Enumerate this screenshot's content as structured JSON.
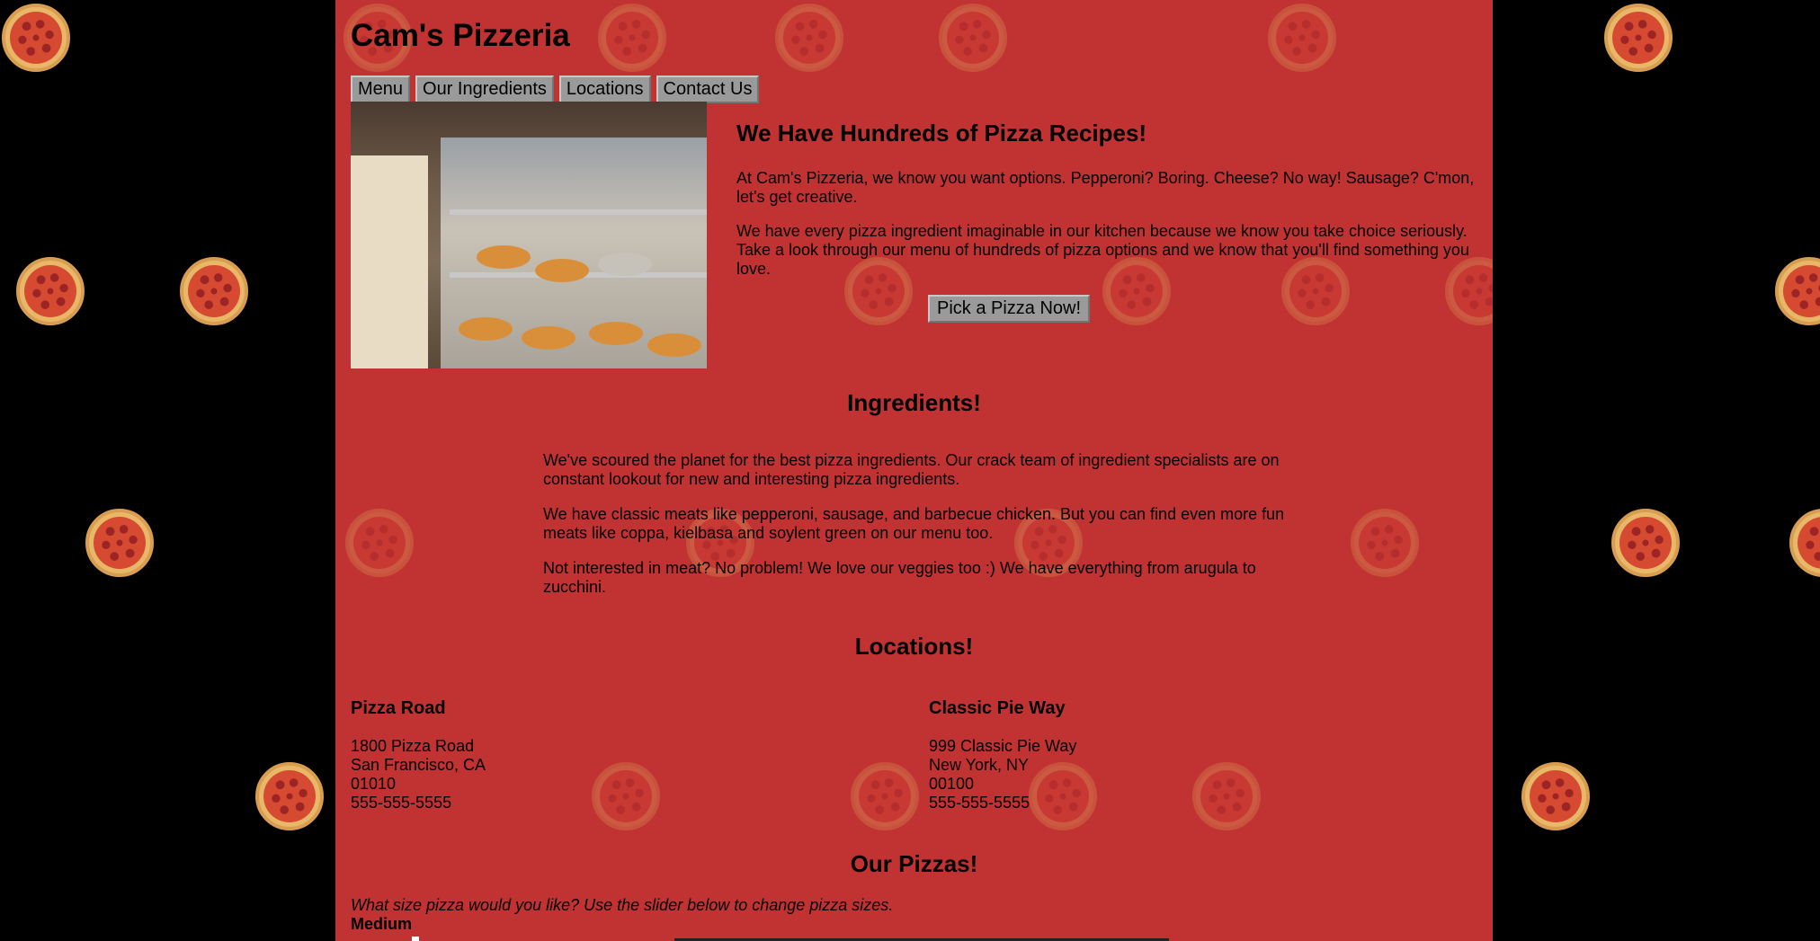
{
  "header": {
    "title": "Cam's Pizzeria"
  },
  "nav": {
    "items": [
      "Menu",
      "Our Ingredients",
      "Locations",
      "Contact Us"
    ]
  },
  "hero": {
    "image_icon": "pizzeria-display-case-photo",
    "heading": "We Have Hundreds of Pizza Recipes!",
    "paragraphs": [
      "At Cam's Pizzeria, we know you want options. Pepperoni? Boring. Cheese? No way! Sausage? C'mon, let's get creative.",
      "We have every pizza ingredient imaginable in our kitchen because we know you take choice seriously. Take a look through our menu of hundreds of pizza options and we know that you'll find something you love."
    ],
    "cta_label": "Pick a Pizza Now!"
  },
  "ingredients": {
    "heading": "Ingredients!",
    "paragraphs": [
      "We've scoured the planet for the best pizza ingredients. Our crack team of ingredient specialists are on constant lookout for new and interesting pizza ingredients.",
      "We have classic meats like pepperoni, sausage, and barbecue chicken. But you can find even more fun meats like coppa, kielbasa and soylent green on our menu too.",
      "Not interested in meat? No problem! We love our veggies too :) We have everything from arugula to zucchini."
    ]
  },
  "locations": {
    "heading": "Locations!",
    "items": [
      {
        "name": "Pizza Road",
        "street": "1800 Pizza Road",
        "city": "San Francisco, CA",
        "zip": "01010",
        "phone": "555-555-5555"
      },
      {
        "name": "Classic Pie Way",
        "street": "999 Classic Pie Way",
        "city": "New York, NY",
        "zip": "00100",
        "phone": "555-555-5555"
      }
    ]
  },
  "pizzas": {
    "heading": "Our Pizzas!",
    "question": "What size pizza would you like? Use the slider below to change pizza sizes.",
    "size_label": "Medium"
  },
  "colors": {
    "page_background": "#000000",
    "content_background": "#c13232",
    "button_background": "#9a9a9a"
  },
  "background_icon": "pepperoni-pizza-icon"
}
